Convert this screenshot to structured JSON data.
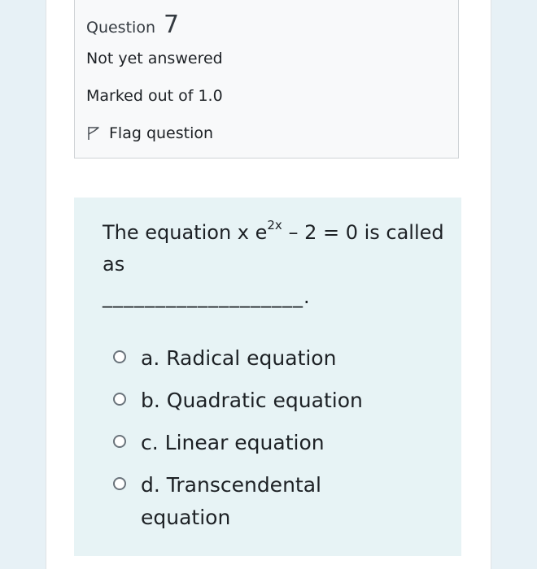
{
  "question_info": {
    "label": "Question",
    "number": "7",
    "state": "Not yet answered",
    "grade": "Marked out of 1.0",
    "flag_label": "Flag question"
  },
  "question": {
    "text_part1": "The equation x e",
    "exponent": "2x",
    "text_part2": " – 2 = 0 is called as",
    "blank": "___________________."
  },
  "answers": [
    {
      "letter": "a.",
      "label": "Radical equation"
    },
    {
      "letter": "b.",
      "label": "Quadratic equation"
    },
    {
      "letter": "c.",
      "label": "Linear equation"
    },
    {
      "letter": "d.",
      "label": "Transcendental equation"
    }
  ],
  "colors": {
    "page_background": "#e7f1f6",
    "question_background": "#e7f3f5",
    "info_background": "#f8f9fa"
  },
  "icons": {
    "flag": "flag-outline-icon",
    "radio": "radio-unchecked-icon"
  }
}
